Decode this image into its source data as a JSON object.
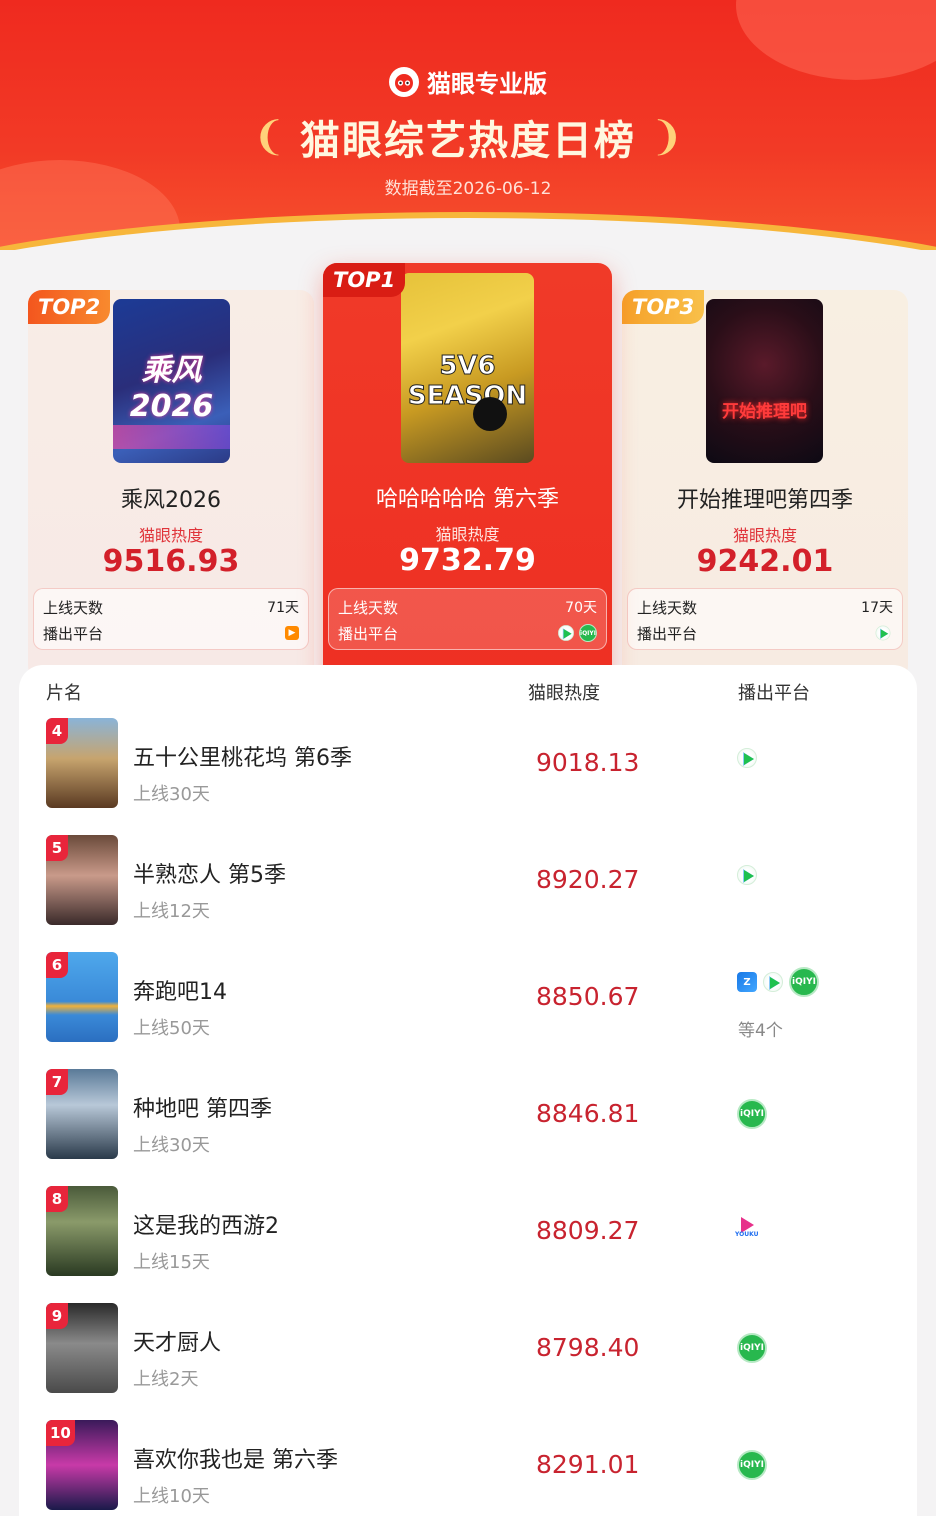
{
  "header": {
    "brand": "猫眼专业版",
    "title": "猫眼综艺热度日榜",
    "date": "数据截至2026-06-12"
  },
  "top3": [
    {
      "badge": "TOP1",
      "name": "哈哈哈哈哈 第六季",
      "heat_label": "猫眼热度",
      "heat": "9732.79",
      "days_label": "上线天数",
      "days": "70天",
      "platform_label": "播出平台",
      "platforms": [
        "tencent-video-icon",
        "iqiyi-icon"
      ],
      "poster_text": "5V6 SEASON"
    },
    {
      "badge": "TOP2",
      "name": "乘风2026",
      "heat_label": "猫眼热度",
      "heat": "9516.93",
      "days_label": "上线天数",
      "days": "71天",
      "platform_label": "播出平台",
      "platforms": [
        "mango-tv-icon"
      ],
      "poster_text": "乘风 2026"
    },
    {
      "badge": "TOP3",
      "name": "开始推理吧第四季",
      "heat_label": "猫眼热度",
      "heat": "9242.01",
      "days_label": "上线天数",
      "days": "17天",
      "platform_label": "播出平台",
      "platforms": [
        "tencent-video-icon"
      ],
      "poster_text": "开始推理吧"
    }
  ],
  "list": {
    "headers": {
      "name": "片名",
      "heat": "猫眼热度",
      "platform": "播出平台"
    },
    "rows": [
      {
        "rank": "4",
        "name": "五十公里桃花坞 第6季",
        "days": "上线30天",
        "heat": "9018.13",
        "platforms": [
          "tencent-video-icon"
        ],
        "more": ""
      },
      {
        "rank": "5",
        "name": "半熟恋人 第5季",
        "days": "上线12天",
        "heat": "8920.27",
        "platforms": [
          "tencent-video-icon"
        ],
        "more": ""
      },
      {
        "rank": "6",
        "name": "奔跑吧14",
        "days": "上线50天",
        "heat": "8850.67",
        "platforms": [
          "zhejiang-tv-icon",
          "tencent-video-icon",
          "iqiyi-icon"
        ],
        "more": "等4个"
      },
      {
        "rank": "7",
        "name": "种地吧 第四季",
        "days": "上线30天",
        "heat": "8846.81",
        "platforms": [
          "iqiyi-icon"
        ],
        "more": ""
      },
      {
        "rank": "8",
        "name": "这是我的西游2",
        "days": "上线15天",
        "heat": "8809.27",
        "platforms": [
          "youku-icon"
        ],
        "more": ""
      },
      {
        "rank": "9",
        "name": "天才厨人",
        "days": "上线2天",
        "heat": "8798.40",
        "platforms": [
          "iqiyi-icon"
        ],
        "more": ""
      },
      {
        "rank": "10",
        "name": "喜欢你我也是 第六季",
        "days": "上线10天",
        "heat": "8291.01",
        "platforms": [
          "iqiyi-icon"
        ],
        "more": ""
      }
    ]
  },
  "colors": {
    "accent": "#ef2a1f",
    "heat_text": "#c8232f",
    "iqiyi": "#28b84e"
  }
}
